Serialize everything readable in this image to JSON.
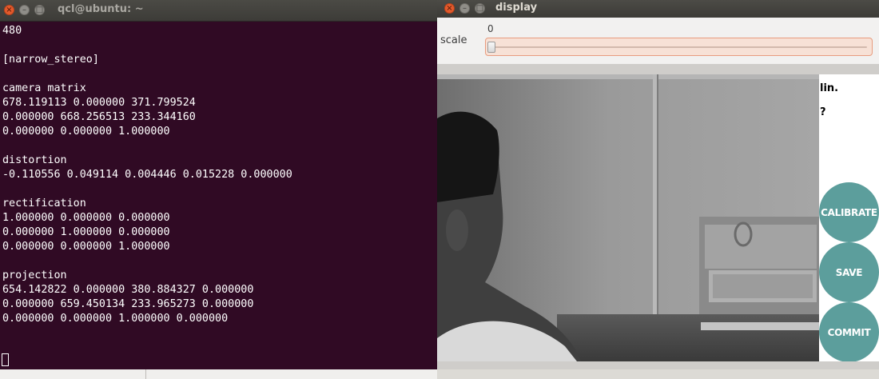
{
  "terminal": {
    "title": "qcl@ubuntu: ~",
    "lines": [
      "480",
      "",
      "[narrow_stereo]",
      "",
      "camera matrix",
      "678.119113 0.000000 371.799524",
      "0.000000 668.256513 233.344160",
      "0.000000 0.000000 1.000000",
      "",
      "distortion",
      "-0.110556 0.049114 0.004446 0.015228 0.000000",
      "",
      "rectification",
      "1.000000 0.000000 0.000000",
      "0.000000 1.000000 0.000000",
      "0.000000 0.000000 1.000000",
      "",
      "projection",
      "654.142822 0.000000 380.884327 0.000000",
      "0.000000 659.450134 233.965273 0.000000",
      "0.000000 0.000000 1.000000 0.000000"
    ]
  },
  "display": {
    "title": "display",
    "scale_label": "scale",
    "scale_value": "0",
    "scale_fraction": 0.0,
    "side_texts": [
      "lin.",
      "?"
    ],
    "buttons": {
      "calibrate": "CALIBRATE",
      "save": "SAVE",
      "commit": "COMMIT"
    }
  },
  "colors": {
    "terminal_bg": "#300a24",
    "button_teal": "#5c9e9c",
    "slider_accent": "#e89c7f"
  }
}
